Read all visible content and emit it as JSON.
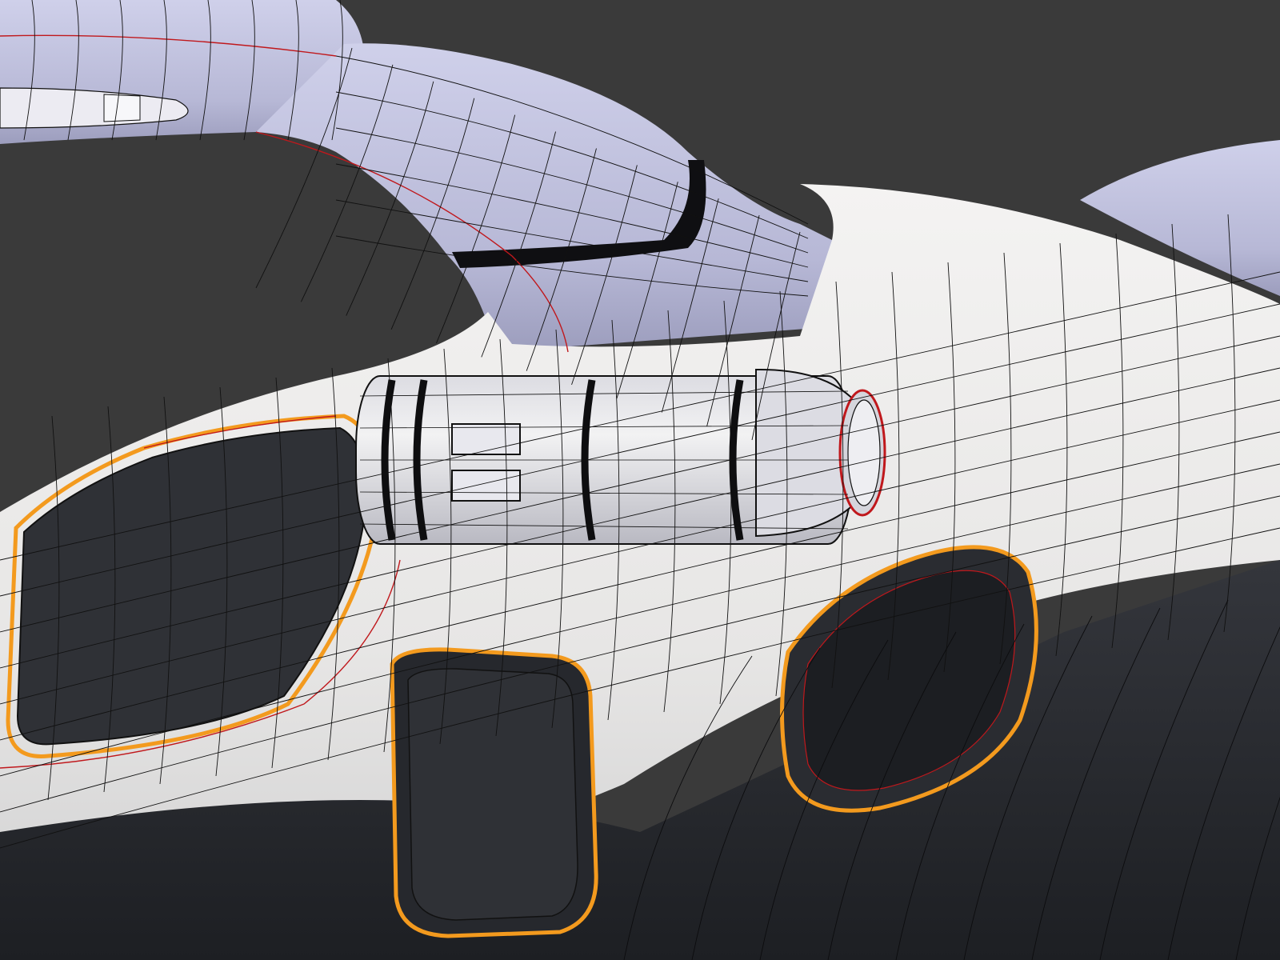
{
  "viewport": {
    "background_color": "#3a3a3a",
    "render_style": "subdivision-mesh-wireframe-overlay"
  },
  "model": {
    "colors": {
      "body_white": "#ecebea",
      "body_shade": "#c9c9cb",
      "arm_lavender": "#c7c8e2",
      "arm_shade": "#9c9dbd",
      "panel_dark": "#2f3136",
      "panel_darker": "#202226",
      "belly_dark": "#26282d",
      "accent_orange": "#f39a1e",
      "seam_red": "#c0181c",
      "wire_black": "#111111",
      "groove_black": "#0e0e10"
    },
    "parts": [
      "fuselage",
      "side-window",
      "lower-hatch",
      "rear-air-intake",
      "cylindrical-thruster",
      "curved-support-arm",
      "ring-structure",
      "rear-fin"
    ]
  }
}
